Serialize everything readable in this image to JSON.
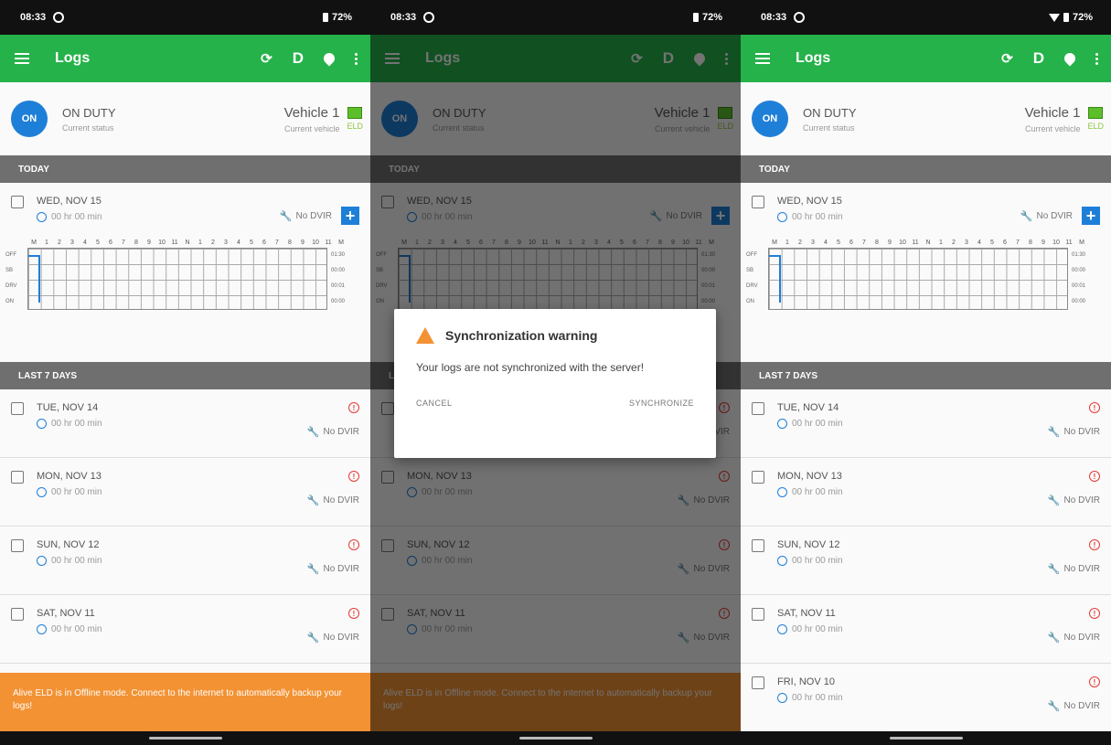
{
  "status_bar": {
    "time": "08:33",
    "battery": "72%"
  },
  "appbar": {
    "title": "Logs",
    "dvir_label": "D"
  },
  "duty": {
    "badge": "ON",
    "status": "ON DUTY",
    "status_caption": "Current status"
  },
  "vehicle": {
    "name": "Vehicle 1",
    "caption": "Current vehicle",
    "eld": "ELD"
  },
  "sections": {
    "today": "TODAY",
    "last7": "LAST 7 DAYS"
  },
  "today": {
    "day": "WED, NOV 15",
    "hours": "00 hr 00 min",
    "dvir": "No DVIR",
    "grid_hours": [
      "M",
      "1",
      "2",
      "3",
      "4",
      "5",
      "6",
      "7",
      "8",
      "9",
      "10",
      "11",
      "N",
      "1",
      "2",
      "3",
      "4",
      "5",
      "6",
      "7",
      "8",
      "9",
      "10",
      "11",
      "M"
    ],
    "grid_rows": [
      "OFF",
      "SB",
      "DRV",
      "ON"
    ],
    "grid_times": [
      "01:30",
      "00:00",
      "00:01",
      "00:00"
    ]
  },
  "logs_a": [
    {
      "day": "TUE, NOV 14",
      "hours": "00 hr 00 min",
      "dvir": "No DVIR"
    },
    {
      "day": "MON, NOV 13",
      "hours": "00 hr 00 min",
      "dvir": "No DVIR"
    },
    {
      "day": "SUN, NOV 12",
      "hours": "00 hr 00 min",
      "dvir": "No DVIR"
    },
    {
      "day": "SAT, NOV 11",
      "hours": "00 hr 00 min",
      "dvir": "No DVIR"
    }
  ],
  "logs_c_extra": {
    "day": "FRI, NOV 10",
    "hours": "00 hr 00 min",
    "dvir": "No DVIR"
  },
  "banner": "Alive ELD is in Offline mode. Connect to the internet to automatically backup your logs!",
  "dialog": {
    "title": "Synchronization warning",
    "message": "Your logs are not synchronized with the server!",
    "cancel": "CANCEL",
    "confirm": "SYNCHRONIZE"
  },
  "colors": {
    "appbar": "#26b24a",
    "accent": "#1e7fd8",
    "banner": "#f39233",
    "alert": "#e53935"
  }
}
